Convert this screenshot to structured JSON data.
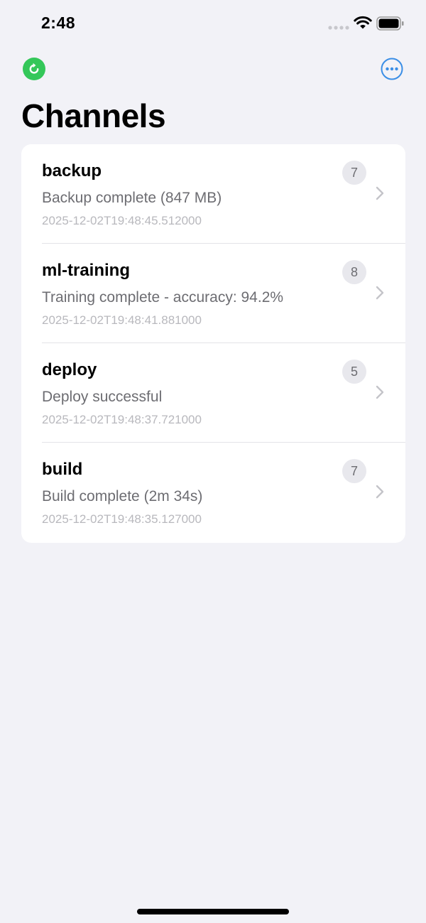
{
  "status_bar": {
    "time": "2:48"
  },
  "header": {
    "title": "Channels",
    "refresh_icon": "refresh-icon",
    "more_icon": "ellipsis-circle-icon",
    "accent_green": "#34c759",
    "accent_blue": "#3a8ee6"
  },
  "channels": [
    {
      "name": "backup",
      "message": "Backup complete (847 MB)",
      "timestamp": "2025-12-02T19:48:45.512000",
      "count": "7"
    },
    {
      "name": "ml-training",
      "message": "Training complete - accuracy: 94.2%",
      "timestamp": "2025-12-02T19:48:41.881000",
      "count": "8"
    },
    {
      "name": "deploy",
      "message": "Deploy successful",
      "timestamp": "2025-12-02T19:48:37.721000",
      "count": "5"
    },
    {
      "name": "build",
      "message": "Build complete (2m 34s)",
      "timestamp": "2025-12-02T19:48:35.127000",
      "count": "7"
    }
  ]
}
